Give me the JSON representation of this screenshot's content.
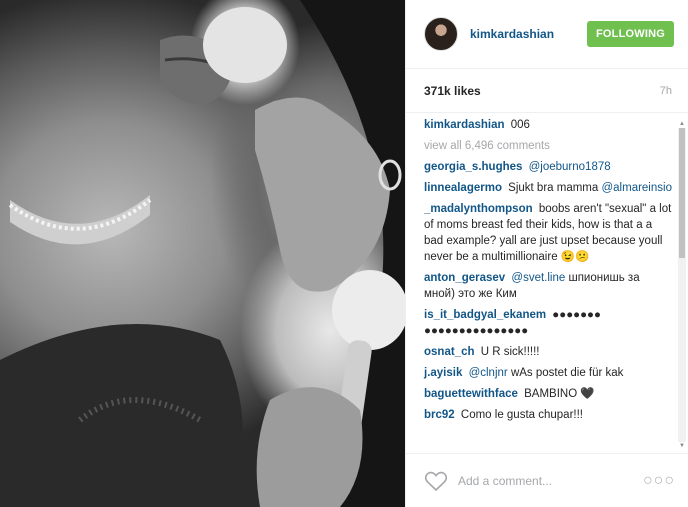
{
  "post": {
    "username": "kimkardashian",
    "follow_label": "FOLLOWING",
    "likes": "371k likes",
    "time": "7h"
  },
  "caption": {
    "user": "kimkardashian",
    "text": "006"
  },
  "view_all": "view all 6,496 comments",
  "comments": [
    {
      "user": "georgia_s.hughes",
      "text": "",
      "mention": "@joeburno1878"
    },
    {
      "user": "linnealagermo",
      "text": "Sjukt bra mamma",
      "mention": "@almareinsio"
    },
    {
      "user": "_madalynthompson",
      "text": "boobs aren't \"sexual\" a lot of moms breast fed their kids, how is that a a bad example? yall are just upset because youll never be a multimillionaire 😉😕",
      "mention": ""
    },
    {
      "user": "anton_gerasev",
      "text": "шпионишь за мной) это же Ким",
      "mention": "@svet.line"
    },
    {
      "user": "is_it_badgyal_ekanem",
      "text": "●●●●●●● ●●●●●●●●●●●●●●●",
      "mention": ""
    },
    {
      "user": "osnat_ch",
      "text": "U R sick!!!!!",
      "mention": ""
    },
    {
      "user": "j.ayisik",
      "text": "wAs postet die für kak",
      "mention": "@clnjnr"
    },
    {
      "user": "baguettewithface",
      "text": "BAMBINO 🖤",
      "mention": ""
    },
    {
      "user": "brc92",
      "text": "Como le gusta chupar!!!",
      "mention": ""
    }
  ],
  "footer": {
    "placeholder": "Add a comment...",
    "more": "○○○",
    "like_icon": "heart-outline-icon"
  },
  "colors": {
    "link": "#125688",
    "follow_bg": "#70c050",
    "muted": "#a5a7aa"
  }
}
